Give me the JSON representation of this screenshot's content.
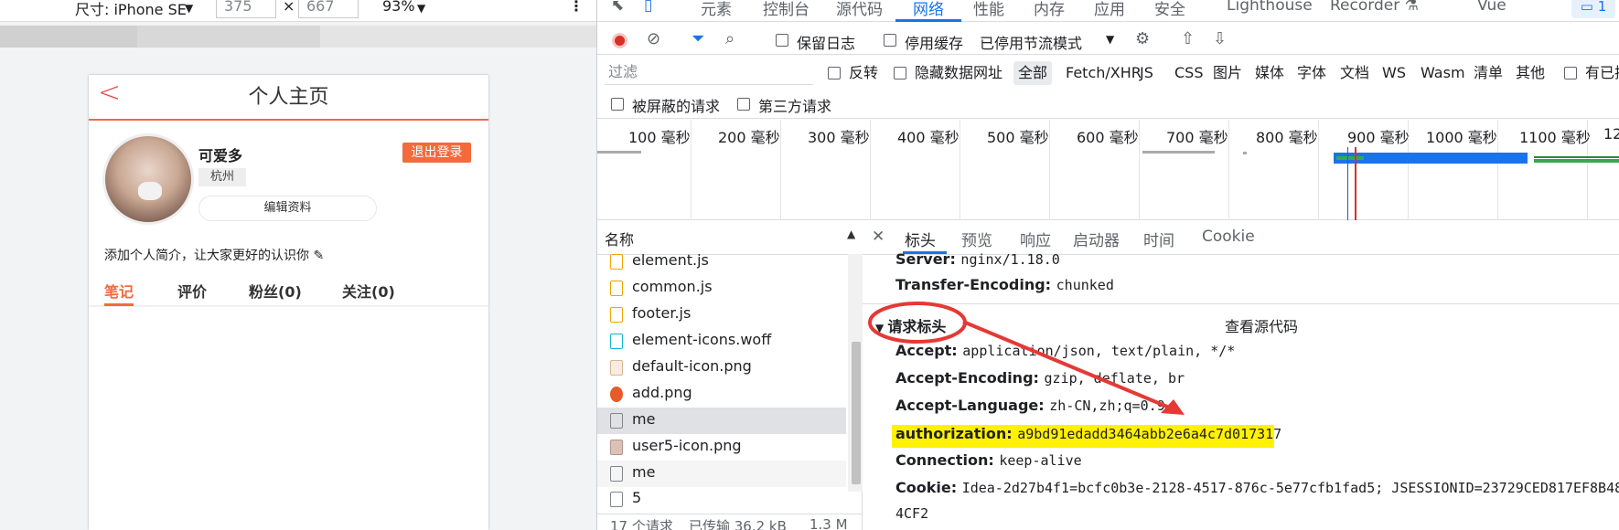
{
  "device_toolbar": {
    "dimensions_label": "尺寸: iPhone SE",
    "width": "375",
    "times": "×",
    "height": "667",
    "zoom": "93%"
  },
  "phone": {
    "title": "个人主页",
    "back": "<",
    "username": "可爱多",
    "city": "杭州",
    "edit_button": "编辑资料",
    "logout_button": "退出登录",
    "intro": "添加个人简介，让大家更好的认识你 ✎",
    "tabs": [
      {
        "label": "笔记"
      },
      {
        "label": "评价"
      },
      {
        "label": "粉丝(0)"
      },
      {
        "label": "关注(0)"
      }
    ]
  },
  "devtools": {
    "tabs": [
      {
        "label": "元素"
      },
      {
        "label": "控制台"
      },
      {
        "label": "源代码"
      },
      {
        "label": "网络"
      },
      {
        "label": "性能"
      },
      {
        "label": "内存"
      },
      {
        "label": "应用"
      },
      {
        "label": "安全"
      },
      {
        "label": "Lighthouse"
      },
      {
        "label": "Recorder ⚗"
      },
      {
        "label": "Vue"
      }
    ],
    "issues_badge": "1",
    "toolbar": {
      "preserve_log": "保留日志",
      "disable_cache": "停用缓存",
      "throttling": "已停用节流模式"
    },
    "filter": {
      "placeholder": "过滤",
      "invert": "反转",
      "hide_data_urls": "隐藏数据网址",
      "types": [
        "全部",
        "Fetch/XHR",
        "JS",
        "CSS",
        "图片",
        "媒体",
        "字体",
        "文档",
        "WS",
        "Wasm",
        "清单",
        "其他"
      ],
      "has_blocked": "有已拦"
    },
    "filter2": {
      "blocked_requests": "被屏蔽的请求",
      "third_party": "第三方请求"
    },
    "timeline_ticks": [
      "100 毫秒",
      "200 毫秒",
      "300 毫秒",
      "400 毫秒",
      "500 毫秒",
      "600 毫秒",
      "700 毫秒",
      "800 毫秒",
      "900 毫秒",
      "1000 毫秒",
      "1100 毫秒",
      "12"
    ],
    "name_header": "名称",
    "requests": [
      {
        "name": "element.js"
      },
      {
        "name": "common.js"
      },
      {
        "name": "footer.js"
      },
      {
        "name": "element-icons.woff"
      },
      {
        "name": "default-icon.png"
      },
      {
        "name": "add.png"
      },
      {
        "name": "me",
        "selected": true
      },
      {
        "name": "user5-icon.png"
      },
      {
        "name": "me"
      },
      {
        "name": "5"
      }
    ],
    "status": {
      "requests": "17 个请求",
      "transferred": "已传输 36.2 kB",
      "size": "1.3 M"
    },
    "detail_tabs": [
      {
        "label": "标头"
      },
      {
        "label": "预览"
      },
      {
        "label": "响应"
      },
      {
        "label": "启动器"
      },
      {
        "label": "时间"
      },
      {
        "label": "Cookie"
      }
    ],
    "response_headers": [
      {
        "k": "Server:",
        "v": "nginx/1.18.0"
      },
      {
        "k": "Transfer-Encoding:",
        "v": "chunked"
      }
    ],
    "request_section": "请求标头",
    "view_source": "查看源代码",
    "request_headers": [
      {
        "k": "Accept:",
        "v": "application/json, text/plain, */*"
      },
      {
        "k": "Accept-Encoding:",
        "v": "gzip, deflate, br"
      },
      {
        "k": "Accept-Language:",
        "v": "zh-CN,zh;q=0.9"
      },
      {
        "k": "authorization:",
        "v": "a9bd91edadd3464abb2e6a4c7d017317"
      },
      {
        "k": "Connection:",
        "v": "keep-alive"
      },
      {
        "k": "Cookie:",
        "v": "Idea-2d27b4f1=bcfc0b3e-2128-4517-876c-5e77cfb1fad5; JSESSIONID=23729CED817EF8B48"
      }
    ],
    "cookie_cont": "4CF2",
    "annotation_color": "#e53935",
    "highlight_color": "#fff200"
  }
}
